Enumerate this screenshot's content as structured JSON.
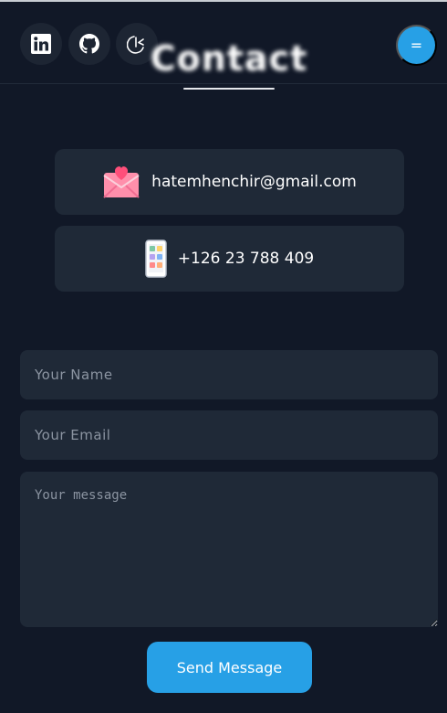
{
  "header": {
    "title": "Contact",
    "menu_label": "="
  },
  "social": [
    {
      "icon": "linkedin-icon"
    },
    {
      "icon": "github-icon"
    },
    {
      "icon": "code-icon"
    }
  ],
  "contact": {
    "email": "hatemhenchir@gmail.com",
    "phone": "+126 23 788 409"
  },
  "form": {
    "name_placeholder": "Your Name",
    "email_placeholder": "Your Email",
    "message_placeholder": "Your message",
    "submit_label": "Send Message"
  },
  "colors": {
    "background": "#111827",
    "card": "#1f2937",
    "accent": "#27a0e6"
  }
}
